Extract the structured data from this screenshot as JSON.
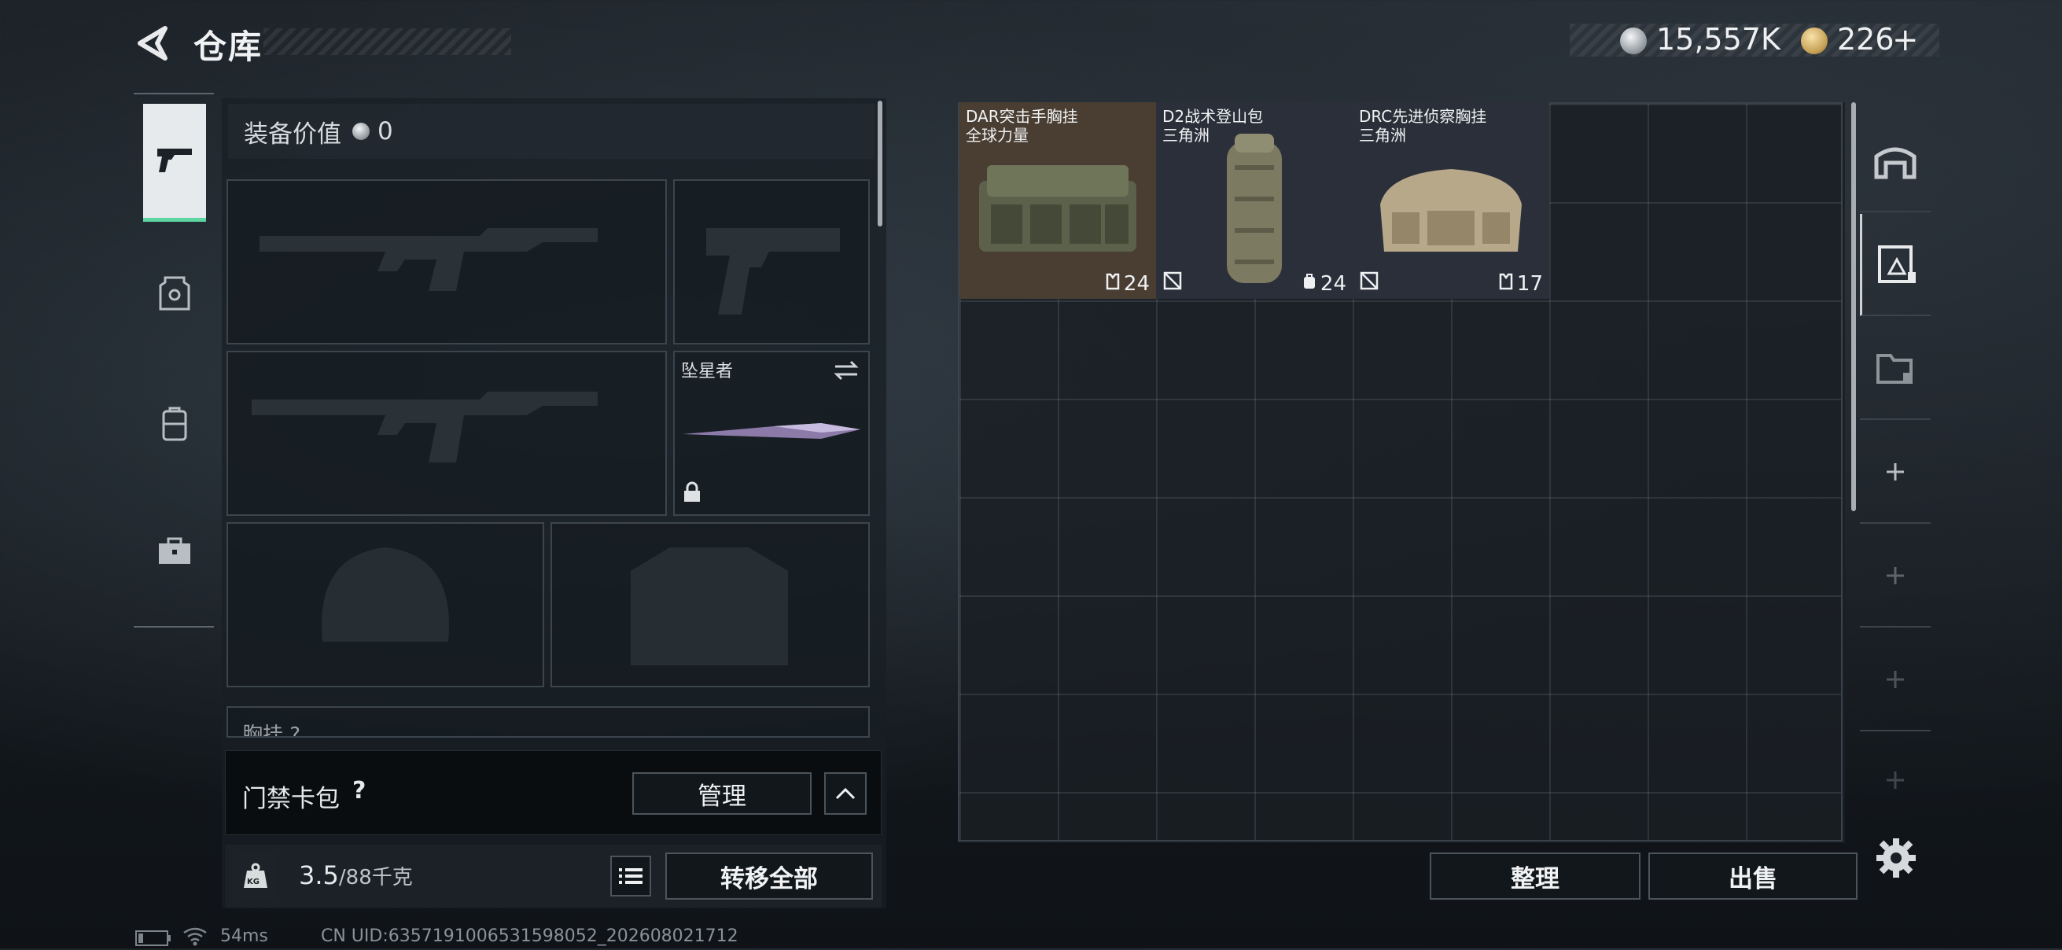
{
  "header": {
    "title": "仓库",
    "silver_amount": "15,557K",
    "gold_amount": "226",
    "gold_plus": "+"
  },
  "category_tabs": [
    {
      "name": "pistol",
      "active": true
    },
    {
      "name": "armor",
      "active": false
    },
    {
      "name": "backpack",
      "active": false
    },
    {
      "name": "toolbox",
      "active": false
    }
  ],
  "loadout": {
    "equipment_value_label": "装备价值",
    "equipment_value": "0",
    "melee_label": "坠星者",
    "chest_rig_label_partial": "胸挂 ?",
    "card_pack_label": "门禁卡包",
    "card_pack_help": "?",
    "manage_button": "管理",
    "weight_value": "3.5",
    "weight_capacity": "/88千克",
    "weight_icon_text": "KG",
    "transfer_all_button": "转移全部"
  },
  "stash": {
    "items": [
      {
        "name": "DAR突击手胸挂\n全球力量",
        "capacity": "24",
        "cap_icon": "vest-icon",
        "flag": false,
        "bg": "#4a3e33"
      },
      {
        "name": "D2战术登山包\n三角洲",
        "capacity": "24",
        "cap_icon": "backpack-icon",
        "flag": true,
        "bg": "#2b2f3a"
      },
      {
        "name": "DRC先进侦察胸挂\n三角洲",
        "capacity": "17",
        "cap_icon": "vest-icon",
        "flag": true,
        "bg": "#2b2f3a"
      }
    ],
    "sort_button": "整理",
    "sell_button": "出售"
  },
  "status_bar": {
    "ping": "54ms",
    "uid": "CN UID:6357191006531598052_202608021712"
  }
}
